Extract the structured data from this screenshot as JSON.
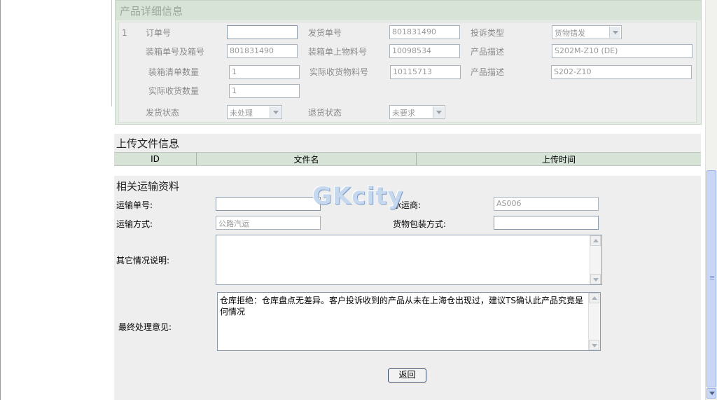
{
  "product_detail": {
    "title": "产品详细信息",
    "row_index": "1",
    "order_no_label": "订单号",
    "order_no_value": "",
    "ship_no_label": "发货单号",
    "ship_no_value": "801831490",
    "complaint_type_label": "投诉类型",
    "complaint_type_value": "货物错发",
    "box_no_label": "装箱单号及箱号",
    "box_no_value": "801831490",
    "box_material_label": "装箱单上物料号",
    "box_material_value": "10098534",
    "product_desc_label_1": "产品描述",
    "product_desc_value_1": "S202M-Z10 (DE)",
    "box_qty_label": "装箱清单数量",
    "box_qty_value": "1",
    "recv_material_label": "实际收货物料号",
    "recv_material_value": "10115713",
    "product_desc_label_2": "产品描述",
    "product_desc_value_2": "S202-Z10",
    "recv_qty_label": "实际收货数量",
    "recv_qty_value": "1",
    "ship_status_label": "发货状态",
    "ship_status_value": "未处理",
    "return_status_label": "退货状态",
    "return_status_value": "未要求"
  },
  "upload": {
    "title": "上传文件信息",
    "columns": [
      "ID",
      "文件名",
      "上传时间"
    ]
  },
  "transport": {
    "title": "相关运输资料",
    "waybill_label": "运输单号:",
    "waybill_value": "",
    "carrier_label": "承运商:",
    "carrier_value": "AS006",
    "mode_label": "运输方式:",
    "mode_value": "公路汽运",
    "packing_label": "货物包装方式:",
    "packing_value": "",
    "other_label": "其它情况说明:",
    "other_value": "",
    "final_label": "最终处理意见:",
    "final_value": "仓库拒绝：仓库盘点无差异。客户投诉收到的产品从未在上海仓出现过，建议TS确认此产品究竟是何情况"
  },
  "actions": {
    "back_label": "返回"
  },
  "watermark": "GKcity",
  "colors": {
    "section_bg": "#eeeeee",
    "header_green": "#d6e3d6",
    "panel_border": "#c5d4c5"
  }
}
